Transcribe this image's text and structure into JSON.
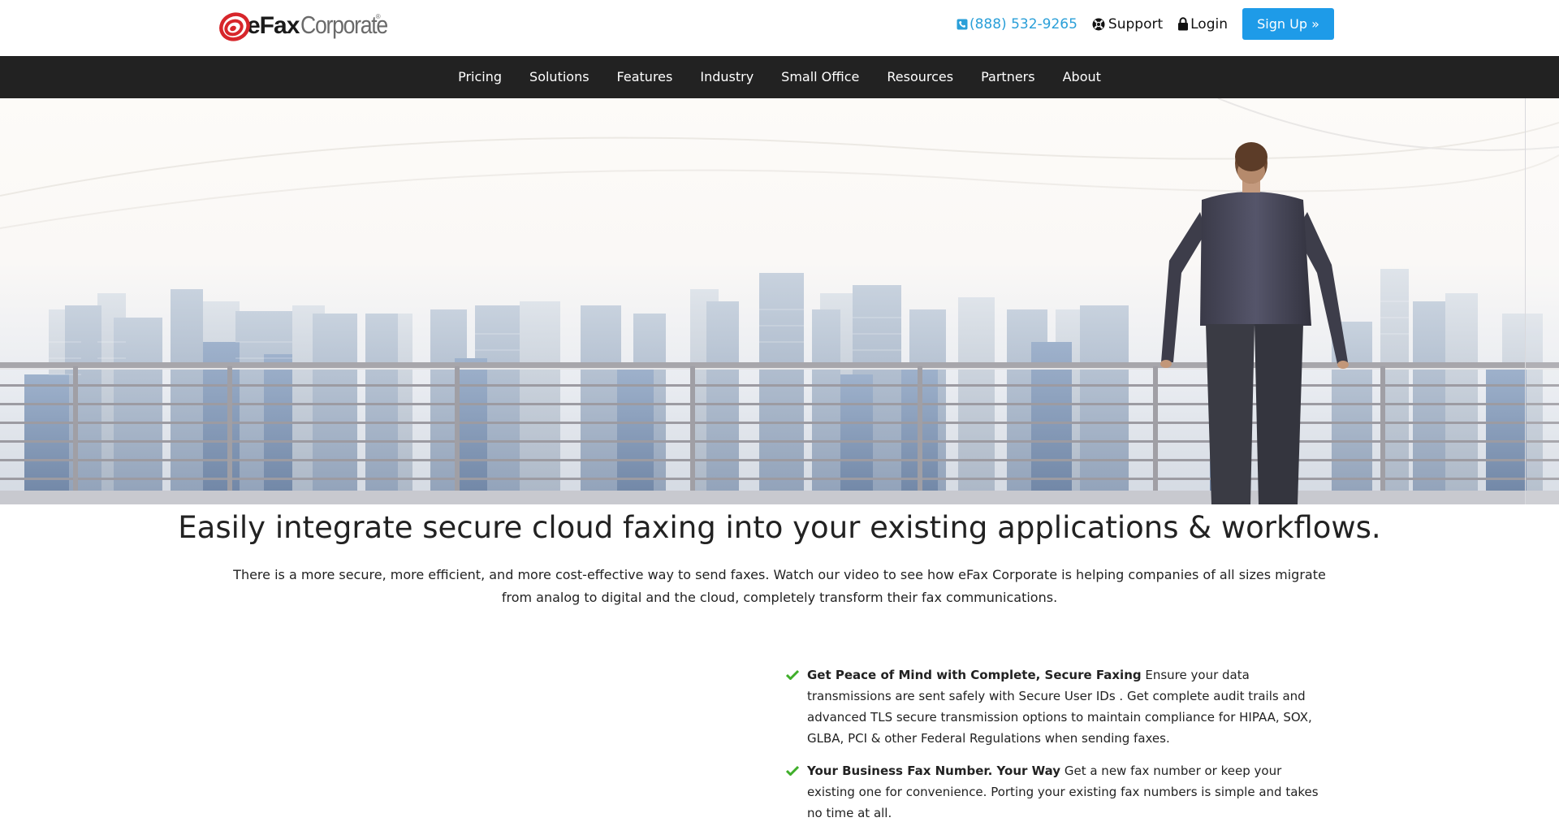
{
  "header": {
    "logo": {
      "brand": "eFax",
      "product": "Corporate",
      "registered": "®"
    },
    "phone": "(888) 532-9265",
    "support_label": "Support",
    "login_label": "Login",
    "signup_label": "Sign Up »"
  },
  "nav": {
    "items": [
      "Pricing",
      "Solutions",
      "Features",
      "Industry",
      "Small Office",
      "Resources",
      "Partners",
      "About"
    ]
  },
  "main": {
    "headline": "Easily integrate secure cloud faxing into your existing applications & workflows.",
    "subtext": "There is a more secure, more efficient, and more cost-effective way to send faxes. Watch our video to see how eFax Corporate is helping companies of all sizes migrate from analog to digital and the cloud, completely transform their fax communications.",
    "features": [
      {
        "title": "Get Peace of Mind with Complete, Secure Faxing",
        "body": " Ensure your data transmissions are sent safely with Secure User IDs . Get complete audit trails and advanced TLS secure transmission options to maintain compliance for HIPAA, SOX, GLBA, PCI & other Federal Regulations when sending faxes."
      },
      {
        "title": "Your Business Fax Number. Your Way",
        "body": " Get a new fax number or keep your existing one for convenience. Porting your existing fax numbers is simple and takes no time at all."
      }
    ]
  },
  "colors": {
    "accent": "#1e9be8",
    "phone": "#2a9fd8",
    "nav_bg": "#222222",
    "check": "#3fae2a",
    "logo_red": "#d7262b"
  },
  "icons": {
    "phone": "phone-icon",
    "support": "lifebuoy-icon",
    "login": "lock-icon",
    "check": "check-icon"
  }
}
